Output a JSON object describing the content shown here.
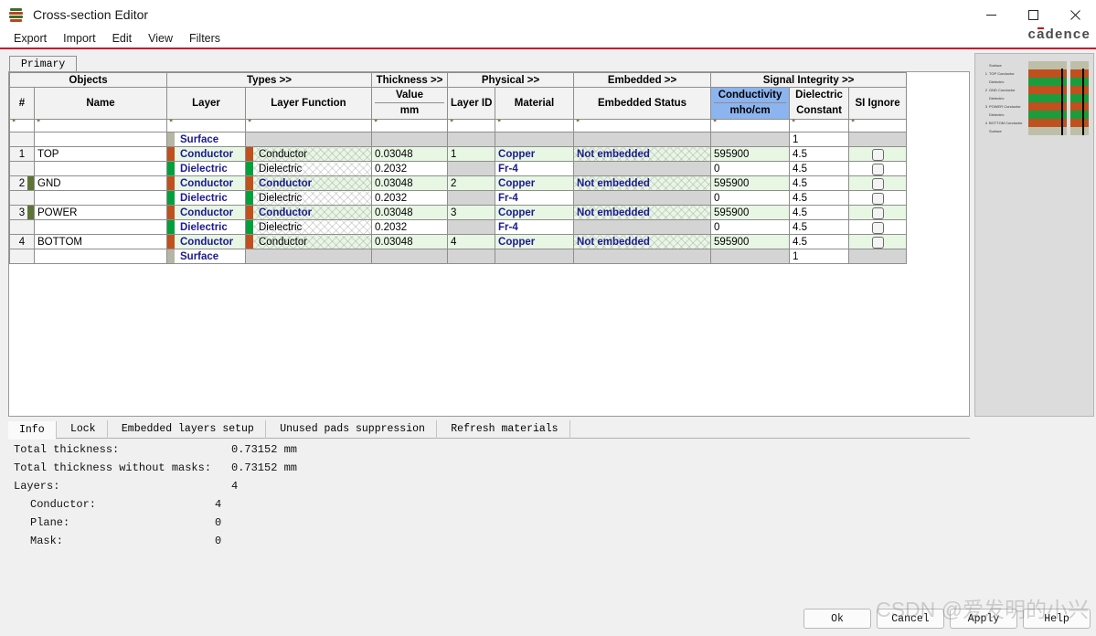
{
  "window": {
    "title": "Cross-section Editor",
    "icon": "stackup-icon",
    "minimize": "−",
    "maximize": "□",
    "close": "✕",
    "brand": "cadence",
    "accent_color": "#c8102e"
  },
  "menu": {
    "items": [
      {
        "label": "Export"
      },
      {
        "label": "Import"
      },
      {
        "label": "Edit"
      },
      {
        "label": "View"
      },
      {
        "label": "Filters"
      }
    ]
  },
  "tabs": {
    "items": [
      {
        "label": "Primary",
        "active": true
      }
    ]
  },
  "table": {
    "groups": [
      {
        "label": "Objects"
      },
      {
        "label": "Types >>"
      },
      {
        "label": "Thickness >>"
      },
      {
        "label": "Physical >>"
      },
      {
        "label": "Embedded >>"
      },
      {
        "label": "Signal Integrity >>"
      }
    ],
    "columns": [
      {
        "key": "num",
        "label": "#"
      },
      {
        "key": "name",
        "label": "Name"
      },
      {
        "key": "layer",
        "label": "Layer"
      },
      {
        "key": "layer_function",
        "label": "Layer Function"
      },
      {
        "key": "thickness",
        "label": "Value",
        "sublabel": "mm"
      },
      {
        "key": "layer_id",
        "label": "Layer ID"
      },
      {
        "key": "material",
        "label": "Material"
      },
      {
        "key": "embedded_status",
        "label": "Embedded Status"
      },
      {
        "key": "conductivity",
        "label": "Conductivity",
        "sublabel": "mho/cm",
        "highlighted": true
      },
      {
        "key": "dielectric_constant",
        "label": "Dielectric",
        "sublabel": "Constant"
      },
      {
        "key": "si_ignore",
        "label": "SI Ignore"
      }
    ],
    "filter_row": {
      "marker": "*"
    },
    "highlight_color": "#8cb4f0",
    "conductor_color": "#c0501e",
    "dielectric_color": "#00a03c",
    "surface_color": "#b6b6a6",
    "rows": [
      {
        "num": "",
        "name": "",
        "layer": "Surface",
        "layer_type": "surface",
        "layer_function": "",
        "thickness": "",
        "layer_id": "",
        "material": "",
        "embedded_status": "",
        "conductivity": "",
        "dielectric_constant": "1",
        "si_ignore": false,
        "shade": "surface",
        "marked": false
      },
      {
        "num": "1",
        "name": "TOP",
        "layer": "Conductor",
        "layer_type": "conductor",
        "layer_function": "Conductor",
        "thickness": "0.03048",
        "layer_id": "1",
        "material": "Copper",
        "embedded_status": "Not embedded",
        "conductivity": "595900",
        "dielectric_constant": "4.5",
        "si_ignore": false,
        "shade": "green",
        "marked": false,
        "bold_function": false
      },
      {
        "num": "",
        "name": "",
        "layer": "Dielectric",
        "layer_type": "dielectric",
        "layer_function": "Dielectric",
        "thickness": "0.2032",
        "layer_id": "",
        "material": "Fr-4",
        "embedded_status": "",
        "conductivity": "0",
        "dielectric_constant": "4.5",
        "si_ignore": false,
        "shade": "white",
        "marked": false,
        "bold_function": false
      },
      {
        "num": "2",
        "name": "GND",
        "layer": "Conductor",
        "layer_type": "conductor",
        "layer_function": "Conductor",
        "thickness": "0.03048",
        "layer_id": "2",
        "material": "Copper",
        "embedded_status": "Not embedded",
        "conductivity": "595900",
        "dielectric_constant": "4.5",
        "si_ignore": false,
        "shade": "green",
        "marked": true,
        "bold_function": true
      },
      {
        "num": "",
        "name": "",
        "layer": "Dielectric",
        "layer_type": "dielectric",
        "layer_function": "Dielectric",
        "thickness": "0.2032",
        "layer_id": "",
        "material": "Fr-4",
        "embedded_status": "",
        "conductivity": "0",
        "dielectric_constant": "4.5",
        "si_ignore": false,
        "shade": "white",
        "marked": false,
        "bold_function": false
      },
      {
        "num": "3",
        "name": "POWER",
        "layer": "Conductor",
        "layer_type": "conductor",
        "layer_function": "Conductor",
        "thickness": "0.03048",
        "layer_id": "3",
        "material": "Copper",
        "embedded_status": "Not embedded",
        "conductivity": "595900",
        "dielectric_constant": "4.5",
        "si_ignore": false,
        "shade": "green",
        "marked": true,
        "bold_function": true
      },
      {
        "num": "",
        "name": "",
        "layer": "Dielectric",
        "layer_type": "dielectric",
        "layer_function": "Dielectric",
        "thickness": "0.2032",
        "layer_id": "",
        "material": "Fr-4",
        "embedded_status": "",
        "conductivity": "0",
        "dielectric_constant": "4.5",
        "si_ignore": false,
        "shade": "white",
        "marked": false,
        "bold_function": false
      },
      {
        "num": "4",
        "name": "BOTTOM",
        "layer": "Conductor",
        "layer_type": "conductor",
        "layer_function": "Conductor",
        "thickness": "0.03048",
        "layer_id": "4",
        "material": "Copper",
        "embedded_status": "Not embedded",
        "conductivity": "595900",
        "dielectric_constant": "4.5",
        "si_ignore": false,
        "shade": "green",
        "marked": false,
        "bold_function": false
      },
      {
        "num": "",
        "name": "",
        "layer": "Surface",
        "layer_type": "surface",
        "layer_function": "",
        "thickness": "",
        "layer_id": "",
        "material": "",
        "embedded_status": "",
        "conductivity": "",
        "dielectric_constant": "1",
        "si_ignore": false,
        "shade": "surface",
        "marked": false
      }
    ]
  },
  "preview": {
    "title": "stackup-preview",
    "rows": [
      {
        "idx": "",
        "label": "Surface",
        "type": "surface"
      },
      {
        "idx": "1",
        "label": "TOP Conductor",
        "type": "conductor"
      },
      {
        "idx": "",
        "label": "Dielectric",
        "type": "dielectric"
      },
      {
        "idx": "2",
        "label": "GND Conductor",
        "type": "conductor"
      },
      {
        "idx": "",
        "label": "Dielectric",
        "type": "dielectric"
      },
      {
        "idx": "3",
        "label": "POWER Conductor",
        "type": "conductor"
      },
      {
        "idx": "",
        "label": "Dielectric",
        "type": "dielectric"
      },
      {
        "idx": "4",
        "label": "BOTTOM Conductor",
        "type": "conductor"
      },
      {
        "idx": "",
        "label": "Surface",
        "type": "surface"
      }
    ]
  },
  "info_tabs": {
    "items": [
      {
        "label": "Info",
        "active": true
      },
      {
        "label": "Lock",
        "active": false
      },
      {
        "label": "Embedded layers setup",
        "active": false
      },
      {
        "label": "Unused pads suppression",
        "active": false
      },
      {
        "label": "Refresh materials",
        "active": false
      }
    ]
  },
  "info": {
    "lines": [
      {
        "label": "Total thickness:",
        "value": "0.73152 mm",
        "indent": 0
      },
      {
        "label": "Total thickness without masks:",
        "value": "0.73152 mm",
        "indent": 0
      },
      {
        "label": "Layers:",
        "value": "4",
        "indent": 0
      },
      {
        "label": "Conductor:",
        "value": "4",
        "indent": 1
      },
      {
        "label": "Plane:",
        "value": "0",
        "indent": 1
      },
      {
        "label": "Mask:",
        "value": "0",
        "indent": 1
      }
    ]
  },
  "footer": {
    "ok": "Ok",
    "cancel": "Cancel",
    "apply": "Apply",
    "help": "Help"
  },
  "watermark": "CSDN @爱发明的小兴"
}
